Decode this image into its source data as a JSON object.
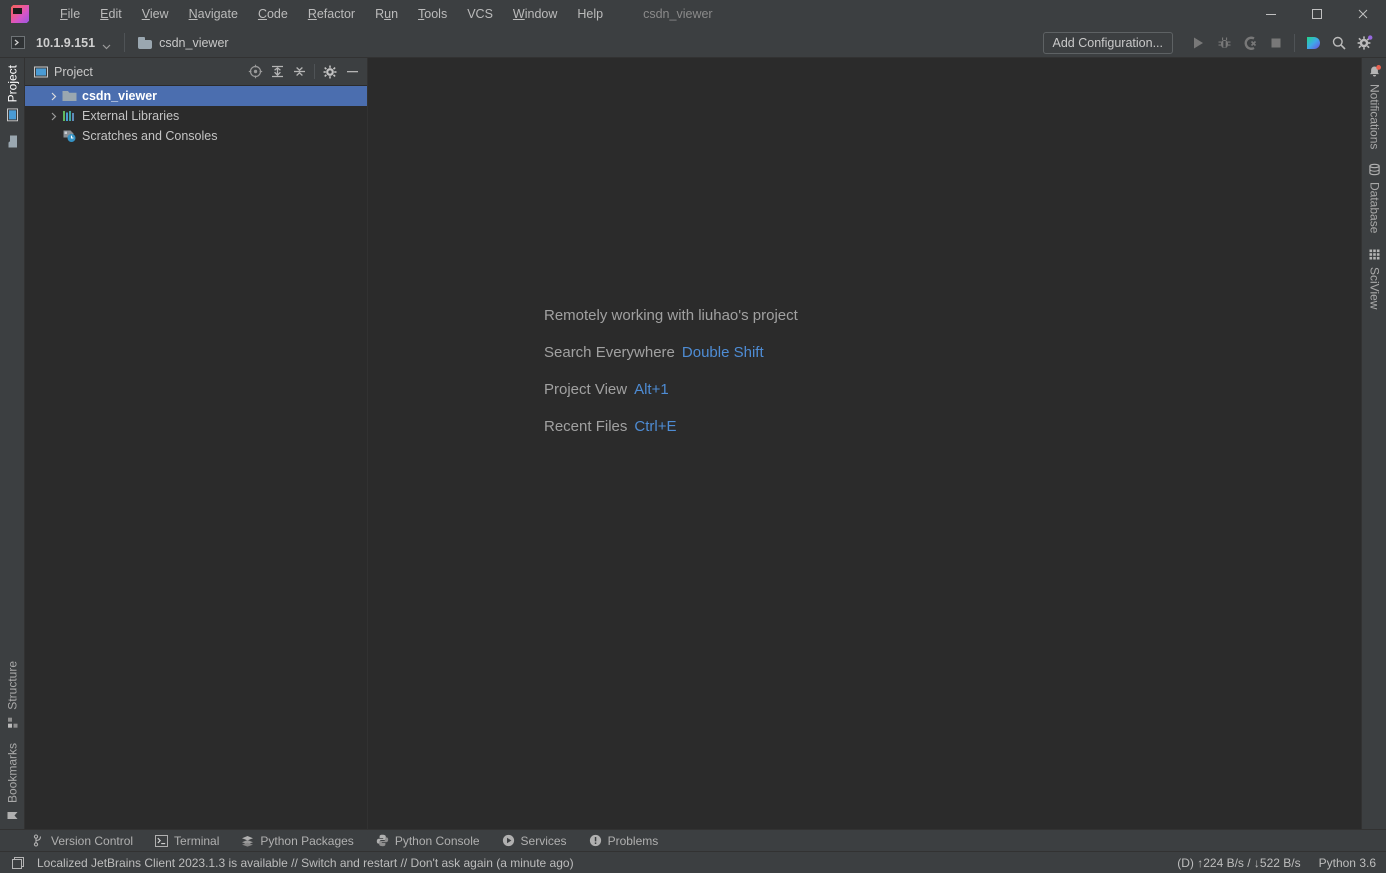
{
  "colors": {
    "window_bg": "#3c3f41",
    "editor_bg": "#2b2b2b",
    "selection_blue": "#4b6eaf",
    "link_blue": "#4e8cd4",
    "text_primary": "#c4c4c4",
    "text_dim": "#a1a1a1",
    "border": "#323232",
    "notification_red": "#e9604f"
  },
  "titlebar": {
    "logo_icon": "pycharm-logo-icon",
    "window_title": "csdn_viewer",
    "menus": [
      {
        "label": "File",
        "mnemonic": "F"
      },
      {
        "label": "Edit",
        "mnemonic": "E"
      },
      {
        "label": "View",
        "mnemonic": "V"
      },
      {
        "label": "Navigate",
        "mnemonic": "N"
      },
      {
        "label": "Code",
        "mnemonic": "C"
      },
      {
        "label": "Refactor",
        "mnemonic": "R"
      },
      {
        "label": "Run",
        "mnemonic": "u"
      },
      {
        "label": "Tools",
        "mnemonic": "T"
      },
      {
        "label": "VCS",
        "mnemonic": ""
      },
      {
        "label": "Window",
        "mnemonic": "W"
      },
      {
        "label": "Help",
        "mnemonic": ""
      }
    ],
    "window_controls": [
      {
        "name": "minimize-button",
        "icon": "minimize-icon"
      },
      {
        "name": "maximize-button",
        "icon": "maximize-icon"
      },
      {
        "name": "close-button",
        "icon": "close-icon"
      }
    ]
  },
  "navbar": {
    "run_target_icon": "remote-host-icon",
    "host": "10.1.9.151",
    "host_chevron_icon": "chevron-down-icon",
    "breadcrumb": [
      {
        "label": "csdn_viewer",
        "icon": "folder-icon"
      }
    ],
    "run_config": {
      "button_label": "Add Configuration...",
      "name": "add-configuration-button"
    },
    "actions": [
      {
        "name": "run-button",
        "icon": "run-icon",
        "enabled": false
      },
      {
        "name": "debug-button",
        "icon": "debug-bug-icon",
        "enabled": false
      },
      {
        "name": "coverage-button",
        "icon": "coverage-icon",
        "enabled": false
      },
      {
        "name": "stop-button",
        "icon": "stop-square-icon",
        "enabled": false
      },
      {
        "name": "ai-assistant-button",
        "icon": "ai-assistant-icon",
        "enabled": true
      },
      {
        "name": "search-button",
        "icon": "search-icon",
        "enabled": true
      },
      {
        "name": "settings-button",
        "icon": "gear-icon",
        "enabled": true
      }
    ]
  },
  "left_stripe": {
    "top_tabs": [
      {
        "label": "Project",
        "icon": "project-window-icon",
        "active": true
      },
      {
        "label": "",
        "icon": "folder-icon",
        "active": false
      }
    ],
    "bottom_tabs": [
      {
        "label": "Structure",
        "icon": "structure-icon",
        "active": false
      },
      {
        "label": "Bookmarks",
        "icon": "bookmark-icon",
        "active": false
      }
    ]
  },
  "right_stripe": {
    "tabs": [
      {
        "label": "Notifications",
        "icon": "bell-icon",
        "badge": true
      },
      {
        "label": "Database",
        "icon": "database-icon",
        "badge": false
      },
      {
        "label": "SciView",
        "icon": "sciview-grid-icon",
        "badge": false
      }
    ]
  },
  "project_panel": {
    "header": {
      "icon": "project-window-icon",
      "title": "Project",
      "buttons": [
        {
          "name": "scroll-from-source-button",
          "icon": "target-crosshair-icon"
        },
        {
          "name": "expand-all-button",
          "icon": "expand-all-icon"
        },
        {
          "name": "collapse-all-button",
          "icon": "collapse-all-icon"
        },
        {
          "name": "options-button",
          "icon": "gear-icon"
        },
        {
          "name": "hide-button",
          "icon": "minus-icon"
        }
      ]
    },
    "tree": [
      {
        "label": "csdn_viewer",
        "icon": "folder-icon",
        "arrow": "collapsed",
        "depth": 0,
        "selected": true,
        "bold": true
      },
      {
        "label": "External Libraries",
        "icon": "libraries-icon",
        "arrow": "collapsed",
        "depth": 0,
        "selected": false,
        "bold": false
      },
      {
        "label": "Scratches and Consoles",
        "icon": "scratches-icon",
        "arrow": "none",
        "depth": 0,
        "selected": false,
        "bold": false
      }
    ]
  },
  "welcome": {
    "heading": "Remotely working with liuhao's project",
    "tips": [
      {
        "action": "Search Everywhere",
        "shortcut": "Double Shift"
      },
      {
        "action": "Project View",
        "shortcut": "Alt+1"
      },
      {
        "action": "Recent Files",
        "shortcut": "Ctrl+E"
      }
    ]
  },
  "bottom_stripe": {
    "tabs": [
      {
        "label": "Version Control",
        "icon": "branch-icon"
      },
      {
        "label": "Terminal",
        "icon": "terminal-icon"
      },
      {
        "label": "Python Packages",
        "icon": "packages-stack-icon"
      },
      {
        "label": "Python Console",
        "icon": "python-icon"
      },
      {
        "label": "Services",
        "icon": "services-play-icon"
      },
      {
        "label": "Problems",
        "icon": "problems-warning-icon"
      }
    ]
  },
  "statusbar": {
    "left_icon": "ide-frame-icon",
    "message": "Localized JetBrains Client 2023.1.3 is available // Switch and restart // Don't ask again (a minute ago)",
    "network": "(D) ↑224 B/s / ↓522 B/s",
    "interpreter": "Python 3.6"
  }
}
